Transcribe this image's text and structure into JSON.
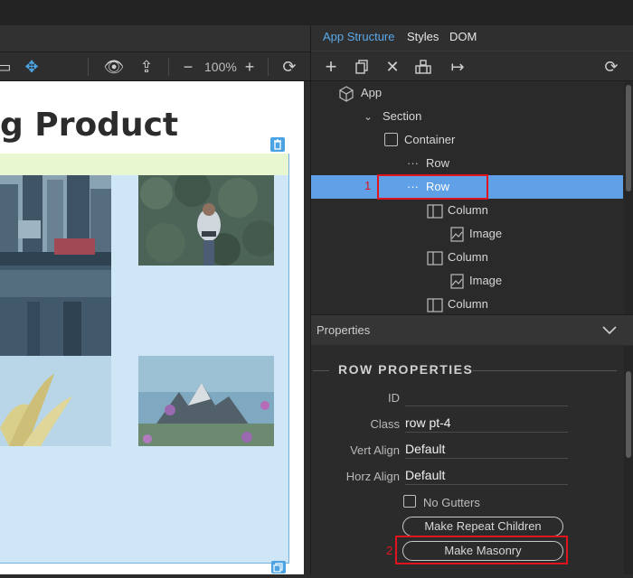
{
  "canvas": {
    "heading": "g Product",
    "zoom": "100%"
  },
  "panel": {
    "tabs": [
      {
        "label": "App Structure",
        "active": true
      },
      {
        "label": "Styles",
        "active": false
      },
      {
        "label": "DOM",
        "active": false
      }
    ],
    "tree": [
      {
        "label": "App",
        "icon": "cube-icon",
        "selected": false
      },
      {
        "label": "Section",
        "icon": "chevrons-icon",
        "selected": false
      },
      {
        "label": "Container",
        "icon": "square-icon",
        "selected": false
      },
      {
        "label": "Row",
        "icon": "dots-icon",
        "selected": false
      },
      {
        "label": "Row",
        "icon": "dots-icon",
        "selected": true
      },
      {
        "label": "Column",
        "icon": "column-icon",
        "selected": false
      },
      {
        "label": "Image",
        "icon": "image-icon",
        "selected": false
      },
      {
        "label": "Column",
        "icon": "column-icon",
        "selected": false
      },
      {
        "label": "Image",
        "icon": "image-icon",
        "selected": false
      },
      {
        "label": "Column",
        "icon": "column-icon",
        "selected": false
      }
    ],
    "markers": {
      "one": "1",
      "two": "2"
    },
    "properties_header": "Properties",
    "row_properties": {
      "title": "ROW PROPERTIES",
      "fields": [
        {
          "label": "ID",
          "value": ""
        },
        {
          "label": "Class",
          "value": "row pt-4"
        },
        {
          "label": "Vert Align",
          "value": "Default"
        },
        {
          "label": "Horz Align",
          "value": "Default"
        }
      ],
      "no_gutters": "No Gutters",
      "repeat_button": "Make Repeat Children",
      "masonry_button": "Make Masonry"
    }
  },
  "colors": {
    "accent": "#5aa9ea",
    "selection": "#5fa0e6",
    "highlight": "#e0141e"
  }
}
